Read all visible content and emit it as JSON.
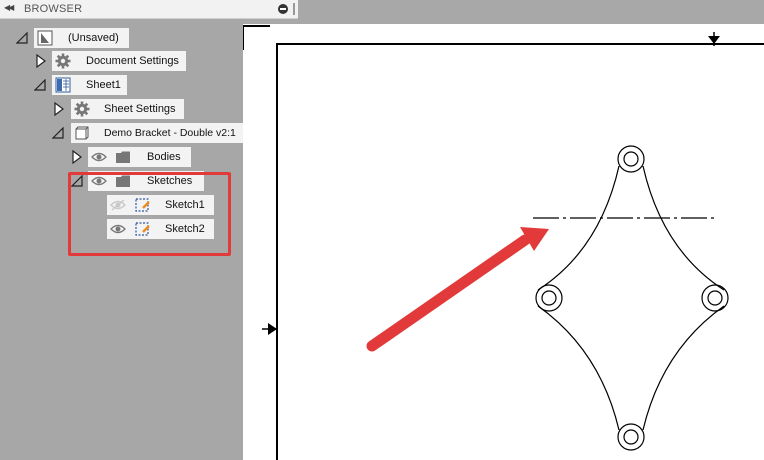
{
  "browser": {
    "title": "BROWSER",
    "tree": [
      {
        "id": "unsaved",
        "label": "(Unsaved)",
        "icon": "document-icon",
        "expanded": true
      },
      {
        "id": "document-settings",
        "label": "Document Settings",
        "icon": "gear-icon",
        "expanded": false
      },
      {
        "id": "sheet1",
        "label": "Sheet1",
        "icon": "sheet-icon",
        "expanded": true
      },
      {
        "id": "sheet-settings",
        "label": "Sheet Settings",
        "icon": "gear-icon",
        "expanded": false
      },
      {
        "id": "demo-bracket",
        "label": "Demo Bracket - Double v2:1",
        "icon": "component-icon",
        "expanded": true
      },
      {
        "id": "bodies",
        "label": "Bodies",
        "icon": "folder-icon",
        "expanded": false,
        "visible": true
      },
      {
        "id": "sketches",
        "label": "Sketches",
        "icon": "folder-icon",
        "expanded": true,
        "visible": true
      },
      {
        "id": "sketch1",
        "label": "Sketch1",
        "icon": "sketch-icon",
        "visible": false
      },
      {
        "id": "sketch2",
        "label": "Sketch2",
        "icon": "sketch-icon",
        "visible": true
      }
    ]
  },
  "colors": {
    "panel": "#a7a7a7",
    "label_bg": "#f3f3f3",
    "highlight": "#e23a3a",
    "canvas": "#ffffff",
    "sketch_orange": "#f08a1c"
  }
}
